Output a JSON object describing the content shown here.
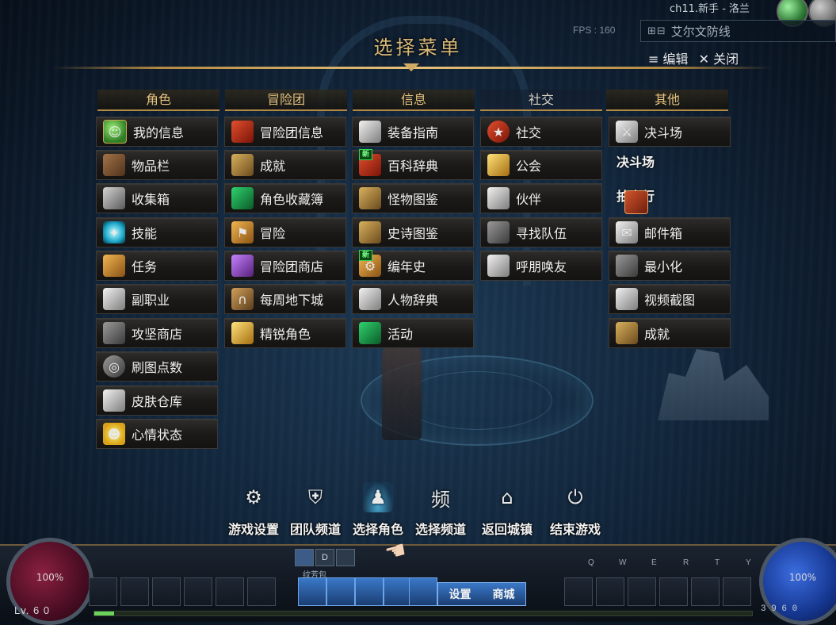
{
  "hud": {
    "fps": "FPS : 160",
    "server_name": "ch11.新手 - 洛兰",
    "location": "艾尔文防线",
    "location_icons": "⊞⊟",
    "hp_pct": "100%",
    "mp_pct": "100%",
    "level": "Lv. 6 0",
    "bag_label": "纹芳包",
    "skill_keys": [
      "Q",
      "W",
      "E",
      "R",
      "T",
      "Y"
    ],
    "quick_tabs": [
      "",
      "D",
      ""
    ],
    "shop_labels": [
      "设置",
      "商城"
    ],
    "money": "3 9 6 0",
    "exp_progress": 0.03
  },
  "menu": {
    "title": "选择菜单",
    "edit_label": "≡ 编辑",
    "close_label": "✕ 关闭"
  },
  "columns": [
    {
      "header": "角色",
      "items": [
        {
          "label": "我的信息",
          "icon": "character-icon"
        },
        {
          "label": "物品栏",
          "icon": "inventory-icon"
        },
        {
          "label": "收集箱",
          "icon": "collection-box-icon"
        },
        {
          "label": "技能",
          "icon": "skill-icon"
        },
        {
          "label": "任务",
          "icon": "quest-scroll-icon"
        },
        {
          "label": "副职业",
          "icon": "potion-icon"
        },
        {
          "label": "攻坚商店",
          "icon": "raid-shop-icon"
        },
        {
          "label": "刷图点数",
          "icon": "dungeon-points-icon"
        },
        {
          "label": "皮肤仓库",
          "icon": "skin-storage-icon"
        },
        {
          "label": "心情状态",
          "icon": "mood-smiley-icon"
        }
      ]
    },
    {
      "header": "冒险团",
      "items": [
        {
          "label": "冒险团信息",
          "icon": "banner-icon"
        },
        {
          "label": "成就",
          "icon": "achievement-scroll-icon"
        },
        {
          "label": "角色收藏簿",
          "icon": "character-album-icon"
        },
        {
          "label": "冒险",
          "icon": "adventure-flag-icon"
        },
        {
          "label": "冒险团商店",
          "icon": "guild-shop-icon"
        },
        {
          "label": "每周地下城",
          "icon": "weekly-dungeon-gate-icon"
        },
        {
          "label": "精锐角色",
          "icon": "elite-character-icon"
        }
      ]
    },
    {
      "header": "信息",
      "items": [
        {
          "label": "装备指南",
          "icon": "equipment-guide-icon"
        },
        {
          "label": "百科辞典",
          "icon": "encyclopedia-book-icon",
          "badge": "新"
        },
        {
          "label": "怪物图鉴",
          "icon": "monster-book-icon"
        },
        {
          "label": "史诗图鉴",
          "icon": "epic-book-icon"
        },
        {
          "label": "编年史",
          "icon": "chronicle-gear-icon",
          "badge": "新"
        },
        {
          "label": "人物辞典",
          "icon": "people-dictionary-icon"
        },
        {
          "label": "活动",
          "icon": "event-calendar-icon"
        }
      ]
    },
    {
      "header": "社交",
      "items": [
        {
          "label": "社交",
          "icon": "social-badge-icon"
        },
        {
          "label": "公会",
          "icon": "guild-eagle-icon"
        },
        {
          "label": "伙伴",
          "icon": "handshake-icon"
        },
        {
          "label": "寻找队伍",
          "icon": "party-finder-icon"
        },
        {
          "label": "呼朋唤友",
          "icon": "penguin-icon"
        }
      ]
    },
    {
      "header": "其他",
      "items": [
        {
          "label": "决斗场",
          "icon": "crossed-swords-icon"
        },
        {
          "label": "邮件箱",
          "icon": "mail-envelope-icon"
        },
        {
          "label": "最小化",
          "icon": "minimize-icon"
        },
        {
          "label": "视频截图",
          "icon": "camera-icon"
        },
        {
          "label": "成就",
          "icon": "achievement-scroll-icon"
        }
      ],
      "floating": [
        "决斗场",
        "拍卖行"
      ]
    }
  ],
  "bottom_menu": [
    {
      "label": "游戏设置",
      "icon": "gear-icon"
    },
    {
      "label": "团队频道",
      "icon": "shield-icon"
    },
    {
      "label": "选择角色",
      "icon": "character-select-icon",
      "active": true
    },
    {
      "label": "选择频道",
      "icon": "channel-icon",
      "glyph": "频"
    },
    {
      "label": "返回城镇",
      "icon": "home-icon"
    },
    {
      "label": "结束游戏",
      "icon": "power-icon"
    }
  ]
}
